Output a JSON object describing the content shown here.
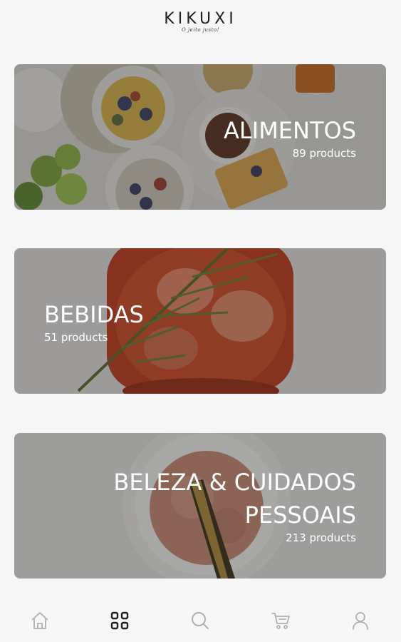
{
  "header": {
    "brand": "KIKUXI",
    "tagline": "O jeito justo!"
  },
  "categories": [
    {
      "title": "ALIMENTOS",
      "count": "89 products"
    },
    {
      "title": "BEBIDAS",
      "count": "51 products"
    },
    {
      "title": "BELEZA & CUIDADOS PESSOAIS",
      "count": "213 products"
    }
  ],
  "tabbar": {
    "items": [
      {
        "icon": "home-icon"
      },
      {
        "icon": "grid-icon"
      },
      {
        "icon": "search-icon"
      },
      {
        "icon": "cart-icon"
      },
      {
        "icon": "user-icon"
      }
    ],
    "active_color": "#222222",
    "inactive_color": "#b0b0b0"
  }
}
